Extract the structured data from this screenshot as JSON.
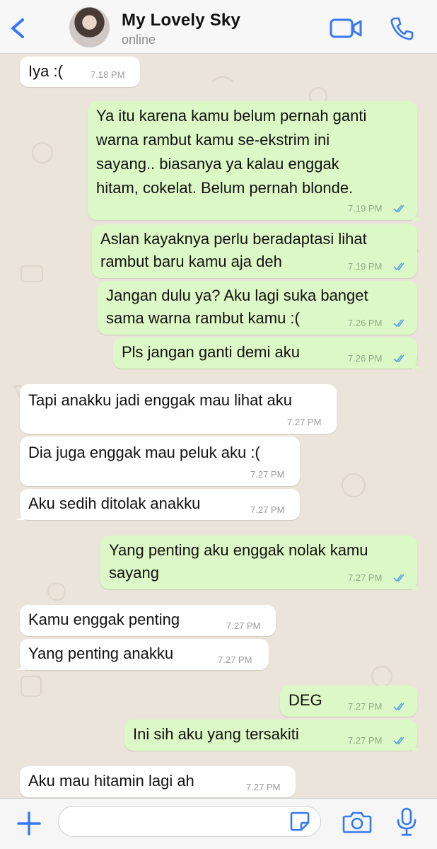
{
  "header": {
    "contact_name": "My Lovely Sky",
    "status": "online",
    "back_icon": "chevron-left-icon",
    "video_icon": "video-camera-icon",
    "call_icon": "phone-icon"
  },
  "colors": {
    "accent": "#3478f6",
    "outgoing_bubble": "#dcf8c6",
    "incoming_bubble": "#ffffff",
    "read_ticks": "#4fa3e8"
  },
  "messages": [
    {
      "direction": "in",
      "lines": [
        "Iya :("
      ],
      "time": "7.18 PM"
    },
    {
      "direction": "out",
      "lines": [
        "Ya itu karena kamu belum pernah ganti",
        "warna rambut kamu se-ekstrim ini",
        "sayang.. biasanya ya kalau enggak",
        "hitam, cokelat. Belum pernah blonde."
      ],
      "time": "7.19 PM",
      "read": true
    },
    {
      "direction": "out",
      "lines": [
        "Aslan kayaknya perlu beradaptasi lihat",
        "rambut baru kamu aja deh"
      ],
      "time": "7.19 PM",
      "read": true
    },
    {
      "direction": "out",
      "lines": [
        "Jangan dulu ya? Aku lagi suka banget",
        "sama warna rambut kamu :("
      ],
      "time": "7.26 PM",
      "read": true
    },
    {
      "direction": "out",
      "lines": [
        "Pls jangan ganti demi aku"
      ],
      "time": "7.26 PM",
      "read": true
    },
    {
      "direction": "in",
      "lines": [
        "Tapi anakku jadi enggak mau lihat aku"
      ],
      "time": "7.27 PM"
    },
    {
      "direction": "in",
      "lines": [
        "Dia juga enggak mau peluk aku :("
      ],
      "time": "7.27 PM"
    },
    {
      "direction": "in",
      "lines": [
        "Aku sedih ditolak anakku"
      ],
      "time": "7.27 PM"
    },
    {
      "direction": "out",
      "lines": [
        "Yang penting aku enggak nolak kamu",
        "sayang"
      ],
      "time": "7.27 PM",
      "read": true
    },
    {
      "direction": "in",
      "lines": [
        "Kamu enggak penting"
      ],
      "time": "7.27 PM"
    },
    {
      "direction": "in",
      "lines": [
        "Yang penting anakku"
      ],
      "time": "7.27 PM"
    },
    {
      "direction": "out",
      "lines": [
        "DEG"
      ],
      "time": "7.27 PM",
      "read": true
    },
    {
      "direction": "out",
      "lines": [
        "Ini sih aku yang tersakiti"
      ],
      "time": "7.27 PM",
      "read": true
    },
    {
      "direction": "in",
      "lines": [
        "Aku mau hitamin lagi ah"
      ],
      "time": "7.27 PM"
    }
  ],
  "composer": {
    "plus_icon": "plus-icon",
    "input_value": "",
    "sticker_icon": "sticker-icon",
    "camera_icon": "camera-icon",
    "mic_icon": "microphone-icon"
  }
}
